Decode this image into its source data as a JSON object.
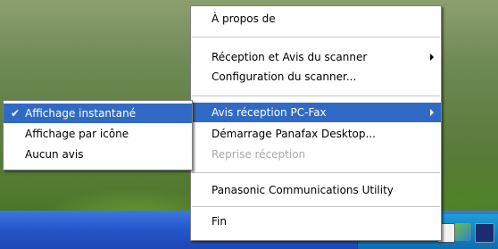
{
  "main_menu": {
    "items": [
      {
        "label": "À propos de"
      },
      {
        "label": "Réception et Avis du scanner"
      },
      {
        "label": "Configuration du scanner..."
      },
      {
        "label": "Avis réception PC-Fax"
      },
      {
        "label": "Démarrage Panafax Desktop..."
      },
      {
        "label": "Reprise réception"
      },
      {
        "label": "Panasonic Communications Utility"
      },
      {
        "label": "Fin"
      }
    ]
  },
  "sub_menu": {
    "items": [
      {
        "label": "Affichage instantané",
        "checked": true
      },
      {
        "label": "Affichage par icône"
      },
      {
        "label": "Aucun avis"
      }
    ]
  },
  "icons": {
    "check": "✔",
    "submenu_arrow": "chevron-right-icon"
  },
  "colors": {
    "highlight": "#316ac5",
    "taskbar": "#2456c9",
    "tray": "#0e7fc2"
  }
}
